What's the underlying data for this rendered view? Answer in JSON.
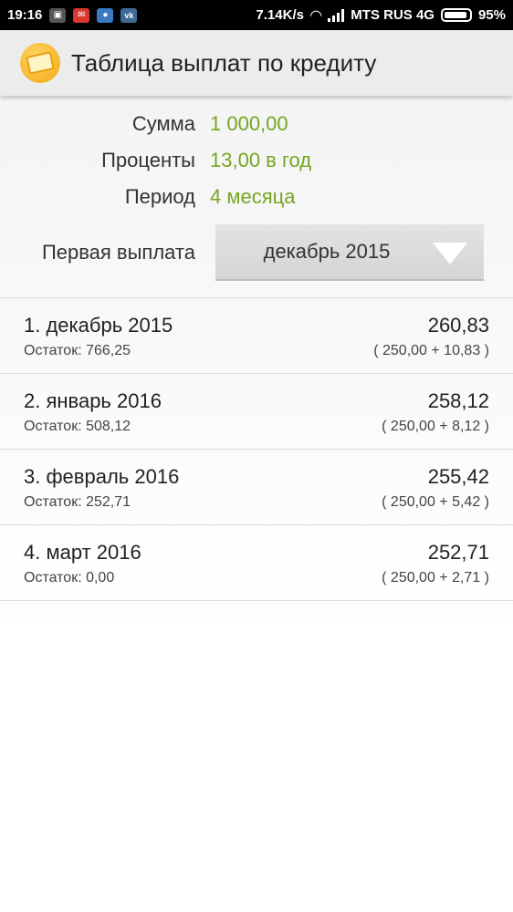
{
  "status_bar": {
    "time": "19:16",
    "speed": "7.14K/s",
    "carrier": "MTS RUS 4G",
    "battery": "95%",
    "battery_level": 0.95,
    "notification_icons": [
      "sim-icon",
      "gmail-icon",
      "message-icon",
      "vk-icon"
    ],
    "vk_label": "vk"
  },
  "app_bar": {
    "title": "Таблица выплат по кредиту",
    "icon": "wallet-icon",
    "icon_color": "#f3a712"
  },
  "summary": {
    "sum_label": "Сумма",
    "sum_value": "1 000,00",
    "interest_label": "Проценты",
    "interest_value": "13,00 в год",
    "period_label": "Период",
    "period_value": "4 месяца",
    "value_color": "#76a521"
  },
  "first_payment": {
    "label": "Первая выплата",
    "selected": "декабрь 2015"
  },
  "payments": [
    {
      "title": "1. декабрь 2015",
      "amount": "260,83",
      "rest": "Остаток: 766,25",
      "parts": "( 250,00 + 10,83 )"
    },
    {
      "title": "2. январь 2016",
      "amount": "258,12",
      "rest": "Остаток: 508,12",
      "parts": "( 250,00 + 8,12 )"
    },
    {
      "title": "3. февраль 2016",
      "amount": "255,42",
      "rest": "Остаток: 252,71",
      "parts": "( 250,00 + 5,42 )"
    },
    {
      "title": "4. март 2016",
      "amount": "252,71",
      "rest": "Остаток: 0,00",
      "parts": "( 250,00 + 2,71 )"
    }
  ]
}
